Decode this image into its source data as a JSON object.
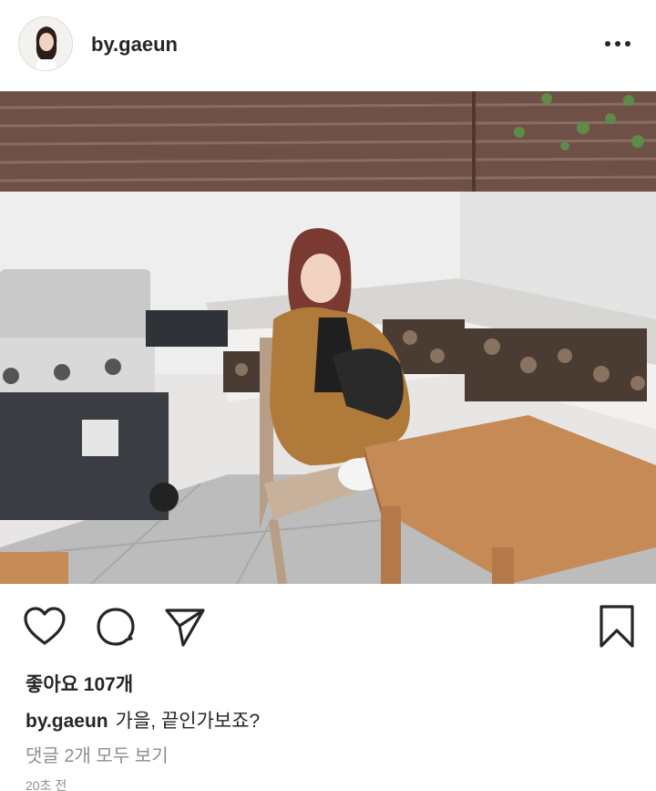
{
  "header": {
    "username": "by.gaeun",
    "avatar_icon": "profile-photo",
    "more_icon": "more-horizontal-icon"
  },
  "post": {
    "photo_description_icon": "post-photo"
  },
  "actions": {
    "like_icon": "heart-icon",
    "comment_icon": "comment-icon",
    "share_icon": "send-icon",
    "save_icon": "bookmark-icon"
  },
  "likes_text": "좋아요 107개",
  "caption": {
    "username": "by.gaeun",
    "text": "가을, 끝인가보죠?"
  },
  "comments_link": "댓글 2개 모두 보기",
  "timestamp": "20초 전",
  "colors": {
    "text": "#262626",
    "secondary": "#8e8e8e",
    "border": "#dbdbdb"
  }
}
